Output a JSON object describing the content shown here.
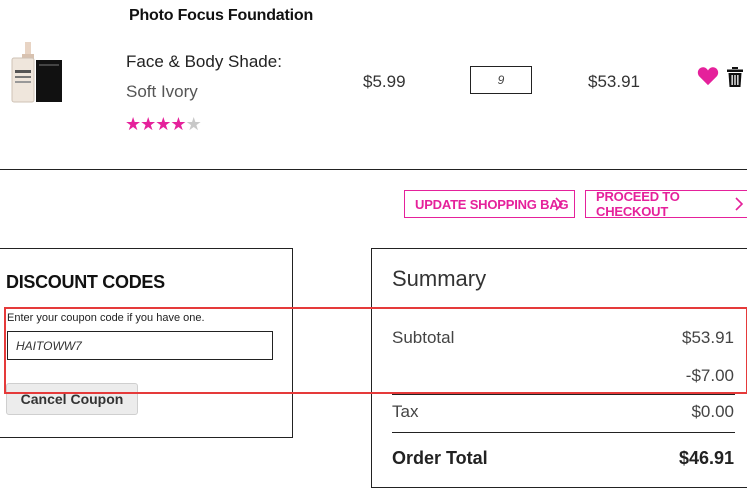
{
  "product": {
    "name": "Photo Focus Foundation",
    "title_line1": "Face & Body Shade:",
    "title_line2": "Soft Ivory",
    "rating": 4,
    "rating_max": 5,
    "price": "$5.99",
    "quantity": "9",
    "line_total": "$53.91"
  },
  "actions": {
    "update_bag": "UPDATE SHOPPING BAG",
    "checkout": "PROCEED TO CHECKOUT"
  },
  "discount": {
    "title": "DISCOUNT CODES",
    "label": "Enter your coupon code if you have one.",
    "code": "HAITOWW7",
    "cancel_label": "Cancel Coupon"
  },
  "summary": {
    "title": "Summary",
    "subtotal_label": "Subtotal",
    "subtotal_value": "$53.91",
    "discount_value": "-$7.00",
    "tax_label": "Tax",
    "tax_value": "$0.00",
    "order_total_label": "Order Total",
    "order_total_value": "$46.91"
  },
  "colors": {
    "accent": "#e5219b",
    "highlight": "#e53a3a"
  }
}
